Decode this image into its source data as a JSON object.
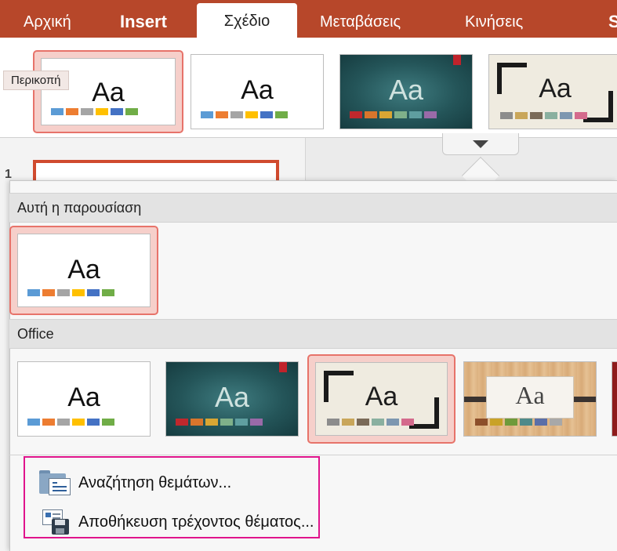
{
  "ribbon": {
    "tabs": [
      {
        "label": "Αρχική"
      },
      {
        "label": "Insert"
      },
      {
        "label": "Σχέδιο"
      },
      {
        "label": "Μεταβάσεις"
      },
      {
        "label": "Κινήσεις"
      }
    ],
    "more_tab_glyph": "S",
    "tooltip": "Περικοπή"
  },
  "slide_pane": {
    "slide_number": "1"
  },
  "theme_sample_text": "Aa",
  "sections": {
    "this_presentation": "Αυτή η παρουσίαση",
    "office": "Office"
  },
  "palettes": {
    "office": [
      "#5b9bd5",
      "#ed7d31",
      "#a5a5a5",
      "#ffc000",
      "#4472c4",
      "#70ad47"
    ],
    "chalk": [
      "#c0282d",
      "#d8752c",
      "#d9a633",
      "#7fb08a",
      "#5f9ea0",
      "#9a6aa8"
    ],
    "frame": [
      "#8c8c8c",
      "#c9a65a",
      "#7a6a58",
      "#8ab0a0",
      "#7d97b0",
      "#d46a8c"
    ],
    "wood": [
      "#8c4e2a",
      "#c9a227",
      "#6f9a3a",
      "#4f8a8a",
      "#5b6fa8",
      "#a8a8a8"
    ]
  },
  "commands": {
    "browse_themes": "Αναζήτηση θεμάτων...",
    "save_current_theme": "Αποθήκευση τρέχοντος θέματος..."
  },
  "colors": {
    "ribbon_accent": "#b7472a",
    "selected_border": "#e7736a",
    "highlight_box": "#e0148c"
  }
}
